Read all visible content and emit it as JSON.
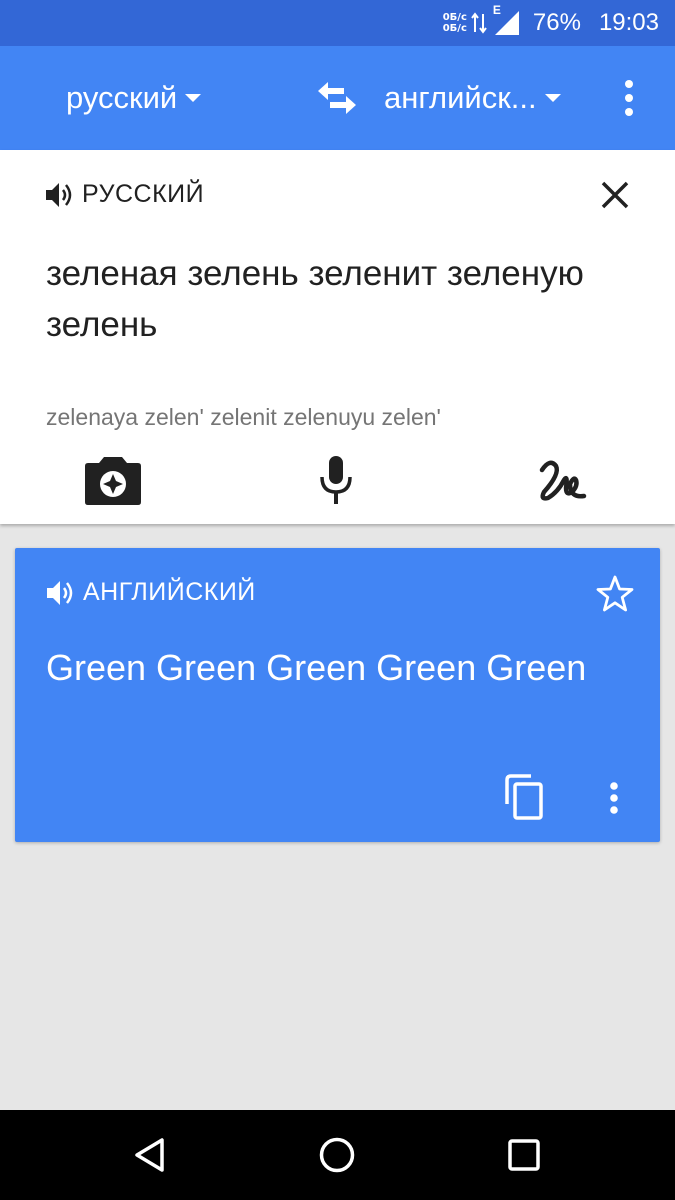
{
  "status_bar": {
    "net_up": "0Б/с",
    "net_down": "0Б/с",
    "network_type": "E",
    "battery": "76%",
    "time": "19:03"
  },
  "toolbar": {
    "source_language": "русский",
    "target_language": "английск...",
    "icons": [
      "swap-icon",
      "more-vert-icon"
    ]
  },
  "source": {
    "language_label": "РУССКИЙ",
    "text": "зеленая зелень зеленит зеленую зелень",
    "transliteration": "zelenaya zelen' zelenit zelenuyu zelen'",
    "icons": [
      "speaker-icon",
      "close-icon",
      "camera-icon",
      "microphone-icon",
      "handwriting-icon"
    ]
  },
  "translation": {
    "language_label": "АНГЛИЙСКИЙ",
    "text": "Green Green Green Green Green",
    "icons": [
      "speaker-icon",
      "star-icon",
      "copy-icon",
      "more-vert-icon"
    ]
  },
  "nav": {
    "icons": [
      "back-icon",
      "home-icon",
      "recents-icon"
    ]
  },
  "colors": {
    "status_bar": "#3367d6",
    "accent": "#4285f4",
    "background": "#e6e6e6"
  }
}
